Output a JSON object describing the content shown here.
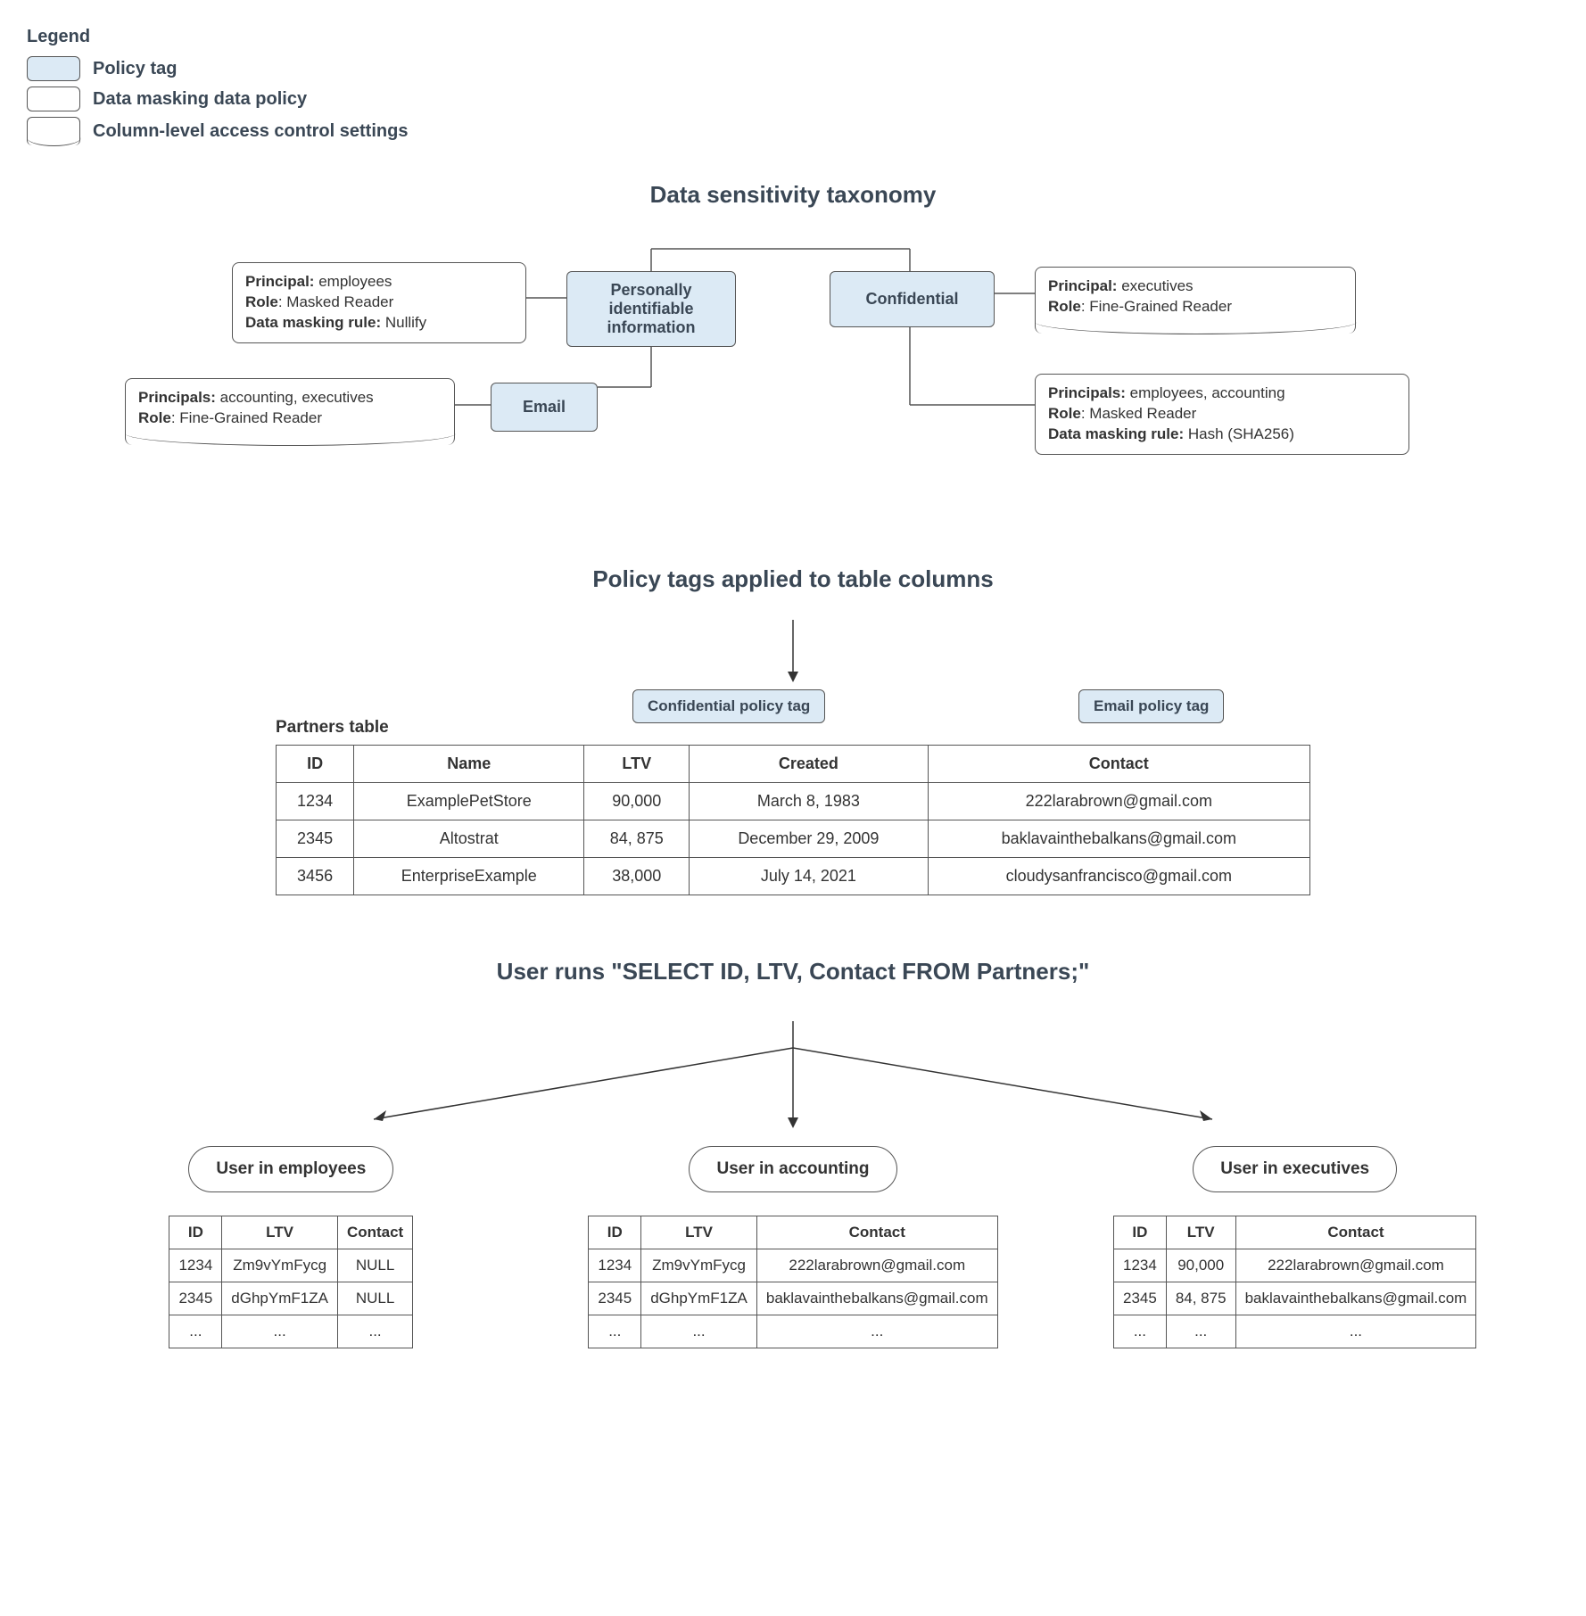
{
  "legend": {
    "title": "Legend",
    "items": [
      {
        "label": "Policy tag"
      },
      {
        "label": "Data masking data policy"
      },
      {
        "label": "Column-level access control settings"
      }
    ]
  },
  "taxonomy": {
    "title": "Data sensitivity taxonomy",
    "tags": {
      "pii": "Personally identifiable information",
      "confidential": "Confidential",
      "email": "Email"
    },
    "pii_policy": {
      "principal_label": "Principal:",
      "principal": "employees",
      "role_label": "Role",
      "role": "Masked Reader",
      "rule_label": "Data masking rule:",
      "rule": "Nullify"
    },
    "email_clacs": {
      "principal_label": "Principals:",
      "principal": "accounting, executives",
      "role_label": "Role",
      "role": "Fine-Grained Reader"
    },
    "conf_clacs": {
      "principal_label": "Principal:",
      "principal": "executives",
      "role_label": "Role",
      "role": "Fine-Grained Reader"
    },
    "conf_policy": {
      "principal_label": "Principals:",
      "principal": "employees, accounting",
      "role_label": "Role",
      "role": "Masked Reader",
      "rule_label": "Data masking rule:",
      "rule": "Hash (SHA256)"
    }
  },
  "columns_section": {
    "title": "Policy tags applied to table columns",
    "table_label": "Partners table",
    "chips": {
      "confidential": "Confidential policy tag",
      "email": "Email policy tag"
    },
    "headers": [
      "ID",
      "Name",
      "LTV",
      "Created",
      "Contact"
    ],
    "rows": [
      [
        "1234",
        "ExamplePetStore",
        "90,000",
        "March 8, 1983",
        "222larabrown@gmail.com"
      ],
      [
        "2345",
        "Altostrat",
        "84, 875",
        "December 29, 2009",
        "baklavainthebalkans@gmail.com"
      ],
      [
        "3456",
        "EnterpriseExample",
        "38,000",
        "July 14, 2021",
        "cloudysanfrancisco@gmail.com"
      ]
    ]
  },
  "query_section": {
    "title": "User runs \"SELECT ID, LTV, Contact FROM Partners;\"",
    "groups": [
      {
        "label": "User in employees",
        "headers": [
          "ID",
          "LTV",
          "Contact"
        ],
        "rows": [
          [
            "1234",
            "Zm9vYmFycg",
            "NULL"
          ],
          [
            "2345",
            "dGhpYmF1ZA",
            "NULL"
          ],
          [
            "...",
            "...",
            "..."
          ]
        ]
      },
      {
        "label": "User in accounting",
        "headers": [
          "ID",
          "LTV",
          "Contact"
        ],
        "rows": [
          [
            "1234",
            "Zm9vYmFycg",
            "222larabrown@gmail.com"
          ],
          [
            "2345",
            "dGhpYmF1ZA",
            "baklavainthebalkans@gmail.com"
          ],
          [
            "...",
            "...",
            "..."
          ]
        ]
      },
      {
        "label": "User in executives",
        "headers": [
          "ID",
          "LTV",
          "Contact"
        ],
        "rows": [
          [
            "1234",
            "90,000",
            "222larabrown@gmail.com"
          ],
          [
            "2345",
            "84, 875",
            "baklavainthebalkans@gmail.com"
          ],
          [
            "...",
            "...",
            "..."
          ]
        ]
      }
    ]
  }
}
